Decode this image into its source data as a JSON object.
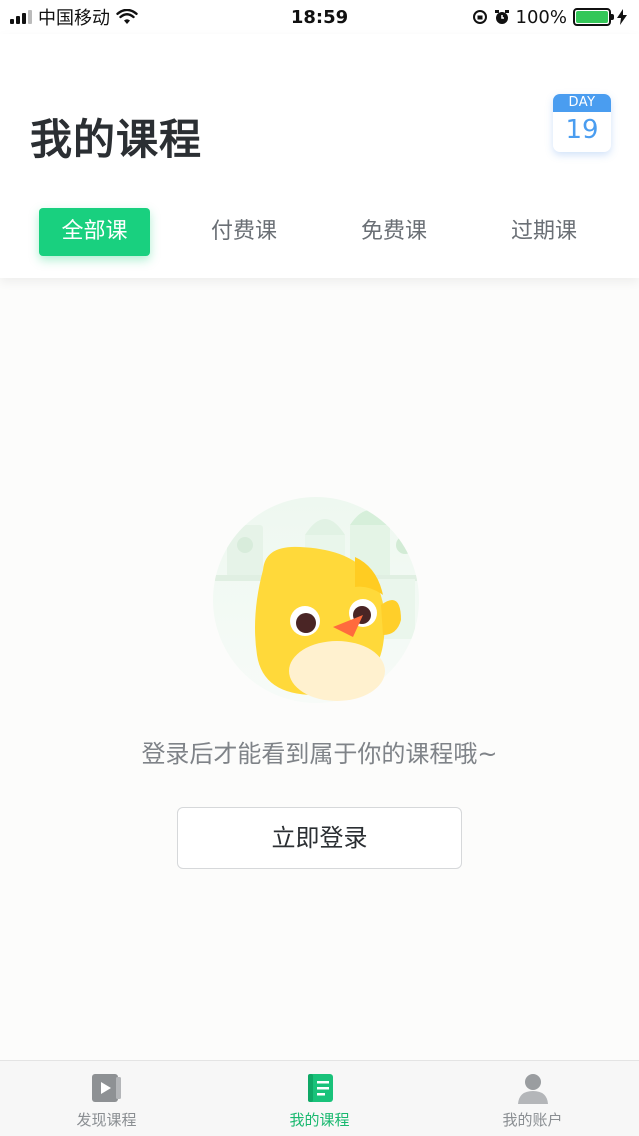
{
  "status_bar": {
    "carrier": "中国移动",
    "time": "18:59",
    "battery": "100%"
  },
  "header": {
    "title": "我的课程",
    "day_badge": {
      "label": "DAY",
      "number": "19"
    }
  },
  "tabs": [
    {
      "label": "全部课",
      "active": true
    },
    {
      "label": "付费课",
      "active": false
    },
    {
      "label": "免费课",
      "active": false
    },
    {
      "label": "过期课",
      "active": false
    }
  ],
  "empty_state": {
    "message": "登录后才能看到属于你的课程哦~",
    "login_button": "立即登录"
  },
  "tab_bar": [
    {
      "label": "发现课程",
      "icon": "play-video-icon",
      "active": false
    },
    {
      "label": "我的课程",
      "icon": "book-icon",
      "active": true
    },
    {
      "label": "我的账户",
      "icon": "person-icon",
      "active": false
    }
  ],
  "colors": {
    "accent": "#19d07f",
    "badge_blue": "#4a9df0",
    "battery_green": "#34c759"
  }
}
